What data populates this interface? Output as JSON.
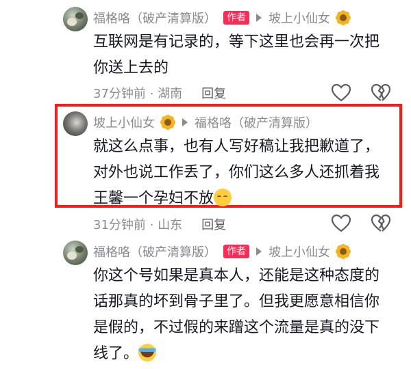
{
  "comments": [
    {
      "author": "福格咯（破产清算版）",
      "badge": "作者",
      "reply_to": "坡上小仙女",
      "text_line1": "互联网是有记录的，等下这里也会再一次把",
      "text_line2": "你送上去的",
      "time_location": "37分钟前 · 湖南",
      "reply_label": "回复"
    },
    {
      "author": "坡上小仙女",
      "reply_to": "福格咯（破产清算版）",
      "text_line1": "就这么点事，也有人写好稿让我把歉道了，",
      "text_line2": "对外也说工作丢了，你们这么多人还抓着我",
      "text_line3": "王馨一个孕妇不放",
      "time_location": "31分钟前 · 山东",
      "reply_label": "回复"
    },
    {
      "author": "福格咯（破产清算版）",
      "badge": "作者",
      "reply_to": "坡上小仙女",
      "text_line1": "你这个号如果是真本人，还能是这种态度的",
      "text_line2": "话那真的坏到骨子里了。但我更愿意相信你",
      "text_line3": "是假的，不过假的来蹭这个流量是真的没下",
      "text_line4": "线了。"
    }
  ],
  "colors": {
    "highlight": "#ff1a1a",
    "badge": "#fe2c55",
    "meta_text": "#8a8b91"
  }
}
